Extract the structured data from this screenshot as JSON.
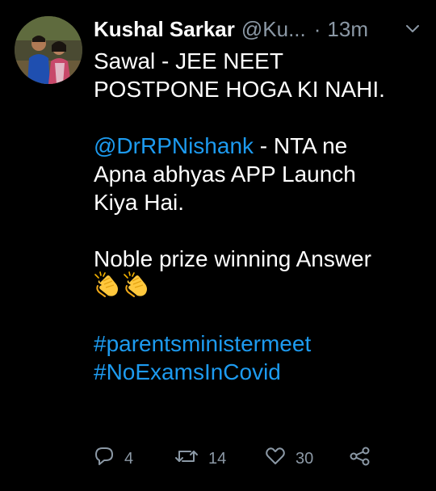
{
  "tweet": {
    "display_name": "Kushal Sarkar",
    "handle": "@Ku...",
    "separator": "·",
    "time": "13m",
    "lines": {
      "l1": "Sawal - JEE NEET",
      "l2": "POSTPONE HOGA KI NAHI.",
      "mention": "@DrRPNishank",
      "l3_rest": " - NTA ne",
      "l4": "Apna abhyas APP Launch",
      "l5": "Kiya Hai.",
      "l6": "Noble prize winning Answer",
      "hashtag1": "#parentsministermeet",
      "hashtag2": "#NoExamsInCovid"
    },
    "emojis": [
      "clapping-hands-emoji",
      "clapping-hands-emoji"
    ]
  },
  "actions": {
    "reply_count": "4",
    "retweet_count": "14",
    "like_count": "30"
  },
  "colors": {
    "background": "#000000",
    "text": "#ffffff",
    "secondary": "#8b98a5",
    "link": "#1d9bf0"
  }
}
